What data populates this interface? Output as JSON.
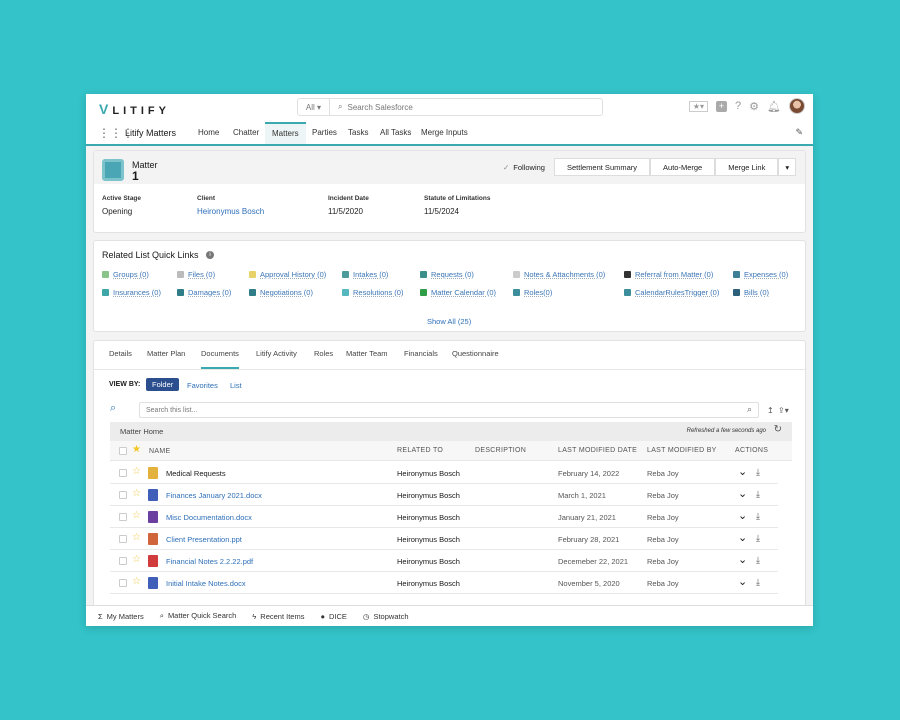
{
  "header": {
    "logo": "LITIFY",
    "search_scope": "All",
    "search_placeholder": "Search Salesforce"
  },
  "nav": {
    "app_name": "Litify Matters",
    "tabs": [
      "Home",
      "Chatter",
      "Matters",
      "Parties",
      "Tasks",
      "All Tasks",
      "Merge Inputs"
    ],
    "active": "Matters"
  },
  "record": {
    "object": "Matter",
    "name": "1",
    "following": "Following",
    "buttons": [
      "Settlement Summary",
      "Auto-Merge",
      "Merge Link"
    ],
    "fields": [
      {
        "label": "Active Stage",
        "value": "Opening"
      },
      {
        "label": "Client",
        "value": "Heironymus Bosch"
      },
      {
        "label": "Incident Date",
        "value": "11/5/2020"
      },
      {
        "label": "Statute of Limitations",
        "value": "11/5/2024"
      }
    ]
  },
  "quick_links": {
    "title": "Related List Quick Links",
    "show_all": "Show All (25)",
    "items": [
      {
        "label": "Groups (0)",
        "color": "#8bc48a"
      },
      {
        "label": "Files (0)",
        "color": "#bbb"
      },
      {
        "label": "Approval History (0)",
        "color": "#e8d36a"
      },
      {
        "label": "Intakes (0)",
        "color": "#4c9a9a"
      },
      {
        "label": "Requests (0)",
        "color": "#3b8f8a"
      },
      {
        "label": "Notes & Attachments (0)",
        "color": "#ccc"
      },
      {
        "label": "Referral from Matter (0)",
        "color": "#333"
      },
      {
        "label": "Expenses (0)",
        "color": "#3d7f96"
      },
      {
        "label": "Insurances (0)",
        "color": "#3fa6a8"
      },
      {
        "label": "Damages (0)",
        "color": "#2f7d86"
      },
      {
        "label": "Negotiations (0)",
        "color": "#2f7d86"
      },
      {
        "label": "Resolutions (0)",
        "color": "#55b8bf"
      },
      {
        "label": "Matter Calendar (0)",
        "color": "#2e9d45"
      },
      {
        "label": "Roles(0)",
        "color": "#3c8e9a"
      },
      {
        "label": "CalendarRulesTrigger (0)",
        "color": "#3c8e9a"
      },
      {
        "label": "Bills (0)",
        "color": "#2c5f7a"
      }
    ]
  },
  "tabs": {
    "items": [
      "Details",
      "Matter Plan",
      "Documents",
      "Litify Activity",
      "Roles",
      "Matter Team",
      "Financials",
      "Questionnaire"
    ],
    "active": "Documents"
  },
  "view_by": {
    "label": "VIEW BY:",
    "options": [
      "Folder",
      "Favorites",
      "List"
    ],
    "active": "Folder"
  },
  "doc_search_placeholder": "Search this list...",
  "table": {
    "folder": "Matter Home",
    "refreshed": "Refreshed a few seconds ago",
    "columns": [
      "NAME",
      "RELATED TO",
      "DESCRIPTION",
      "LAST MODIFIED DATE",
      "LAST MODIFIED BY",
      "ACTIONS"
    ],
    "rows": [
      {
        "name": "Medical Requests",
        "related": "Heironymus Bosch",
        "description": "",
        "date": "February 14, 2022",
        "by": "Reba Joy",
        "icon": "folder",
        "color": "#e3b23c"
      },
      {
        "name": "Finances January 2021.docx",
        "related": "Heironymus Bosch",
        "description": "",
        "date": "March 1, 2021",
        "by": "Reba Joy",
        "icon": "docx",
        "color": "#3f5fb8"
      },
      {
        "name": "Misc Documentation.docx",
        "related": "Heironymus Bosch",
        "description": "",
        "date": "January 21, 2021",
        "by": "Reba Joy",
        "icon": "docx",
        "color": "#6b3fa0"
      },
      {
        "name": "Client Presentation.ppt",
        "related": "Heironymus Bosch",
        "description": "",
        "date": "February 28, 2021",
        "by": "Reba Joy",
        "icon": "ppt",
        "color": "#d0643a"
      },
      {
        "name": "Financial Notes 2.2.22.pdf",
        "related": "Heironymus Bosch",
        "description": "",
        "date": "Decemeber 22, 2021",
        "by": "Reba Joy",
        "icon": "pdf",
        "color": "#d23b3b"
      },
      {
        "name": "Initial Intake Notes.docx",
        "related": "Heironymus Bosch",
        "description": "",
        "date": "November 5, 2020",
        "by": "Reba Joy",
        "icon": "docx",
        "color": "#3f5fb8"
      }
    ]
  },
  "utility_bar": [
    {
      "label": "My Matters",
      "icon": "Σ"
    },
    {
      "label": "Matter Quick Search",
      "icon": "⌕"
    },
    {
      "label": "Recent Items",
      "icon": "ϟ"
    },
    {
      "label": "DICE",
      "icon": "●"
    },
    {
      "label": "Stopwatch",
      "icon": "◷"
    }
  ]
}
